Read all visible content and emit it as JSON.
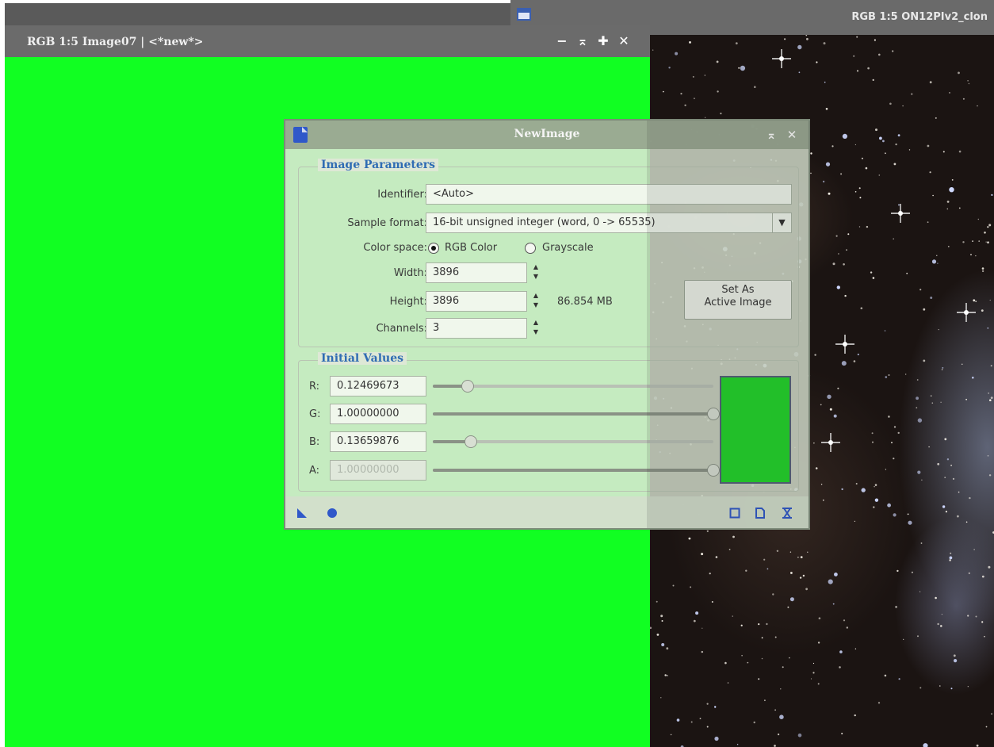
{
  "background_window": {
    "title": "RGB 1:5 ON12PIv2_clon"
  },
  "main_window": {
    "title": "RGB 1:5 Image07 | <*new*>",
    "buttons": {
      "minimize": "−",
      "shade": "⌅",
      "maximize": "✚",
      "close": "✕"
    },
    "fill_color": "#11ff22"
  },
  "dialog": {
    "title": "NewImage",
    "title_buttons": {
      "shade": "⌅",
      "close": "✕"
    },
    "image_parameters": {
      "group_title": "Image Parameters",
      "identifier_label": "Identifier:",
      "identifier_value": "<Auto>",
      "sample_format_label": "Sample format:",
      "sample_format_value": "16-bit unsigned integer (word, 0 -> 65535)",
      "color_space_label": "Color space:",
      "color_space_options": [
        "RGB Color",
        "Grayscale"
      ],
      "color_space_selected": "RGB Color",
      "width_label": "Width:",
      "width_value": "3896",
      "height_label": "Height:",
      "height_value": "3896",
      "size_readout": "86.854 MB",
      "channels_label": "Channels:",
      "channels_value": "3",
      "set_active_button": [
        "Set As",
        "Active Image"
      ]
    },
    "initial_values": {
      "group_title": "Initial Values",
      "channels": [
        {
          "label": "R:",
          "value": "0.12469673",
          "level": 0.1247,
          "enabled": true
        },
        {
          "label": "G:",
          "value": "1.00000000",
          "level": 1.0,
          "enabled": true
        },
        {
          "label": "B:",
          "value": "0.13659876",
          "level": 0.1366,
          "enabled": true
        },
        {
          "label": "A:",
          "value": "1.00000000",
          "level": 1.0,
          "enabled": false
        }
      ],
      "swatch_color": "#22d42a"
    },
    "footer_icons": [
      "new-instance-icon",
      "global-execute-icon",
      "reset-icon",
      "preferences-icon",
      "expand-icon"
    ]
  }
}
